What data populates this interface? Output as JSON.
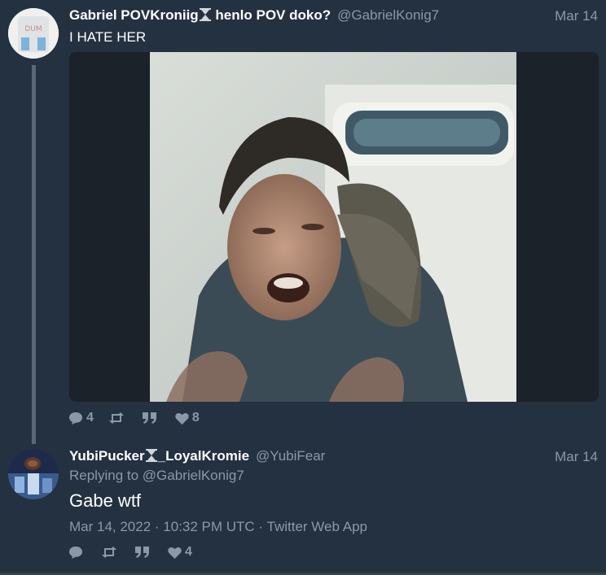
{
  "tweet1": {
    "fullname_part1": "Gabriel POVKroniig",
    "fullname_part2": " henlo POV doko?",
    "username": "@GabrielKonig7",
    "date": "Mar 14",
    "text": "I HATE HER",
    "avatar_label": "DUM",
    "stats": {
      "replies": "4",
      "retweets": "",
      "quotes": "",
      "likes": "8"
    }
  },
  "tweet2": {
    "fullname_part1": "YubiPucker",
    "fullname_part2": "_LoyalKromie",
    "username": "@YubiFear",
    "date": "Mar 14",
    "replying_prefix": "Replying to ",
    "replying_to": "@GabrielKonig7",
    "text": "Gabe wtf",
    "published": "Mar 14, 2022 · 10:32 PM UTC · Twitter Web App",
    "stats": {
      "replies": "",
      "retweets": "",
      "quotes": "",
      "likes": "4"
    }
  },
  "icons": [
    "hourglass-icon",
    "reply-icon",
    "retweet-icon",
    "quote-icon",
    "heart-icon"
  ],
  "colors": {
    "background": "#243140",
    "muted_text": "#8b98a5",
    "thread_line": "#5a6876"
  }
}
